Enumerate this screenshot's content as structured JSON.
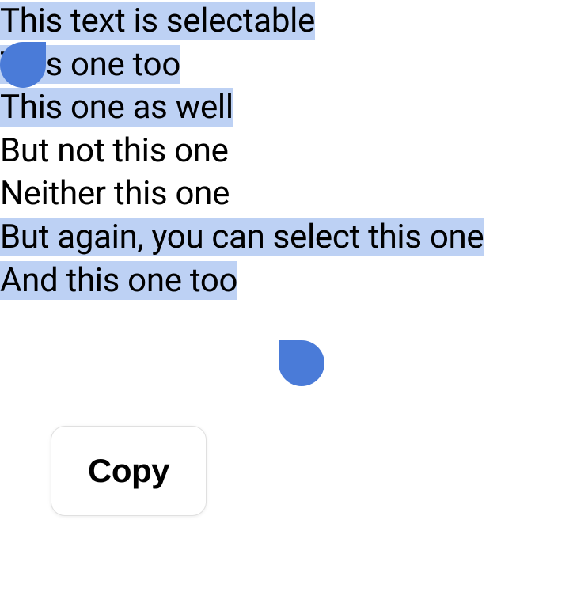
{
  "lines": [
    {
      "text": "This text is selectable",
      "selected": true
    },
    {
      "text": "This one too",
      "selected": true
    },
    {
      "text": "This one as well",
      "selected": true
    },
    {
      "text": "But not this one",
      "selected": false
    },
    {
      "text": "Neither this one",
      "selected": false
    },
    {
      "text": "But again, you can select this one",
      "selected": true
    },
    {
      "text": "And this one too",
      "selected": true
    }
  ],
  "contextMenu": {
    "copy": "Copy"
  },
  "colors": {
    "selection": "#bdd1f4",
    "handle": "#4a7bd8"
  }
}
